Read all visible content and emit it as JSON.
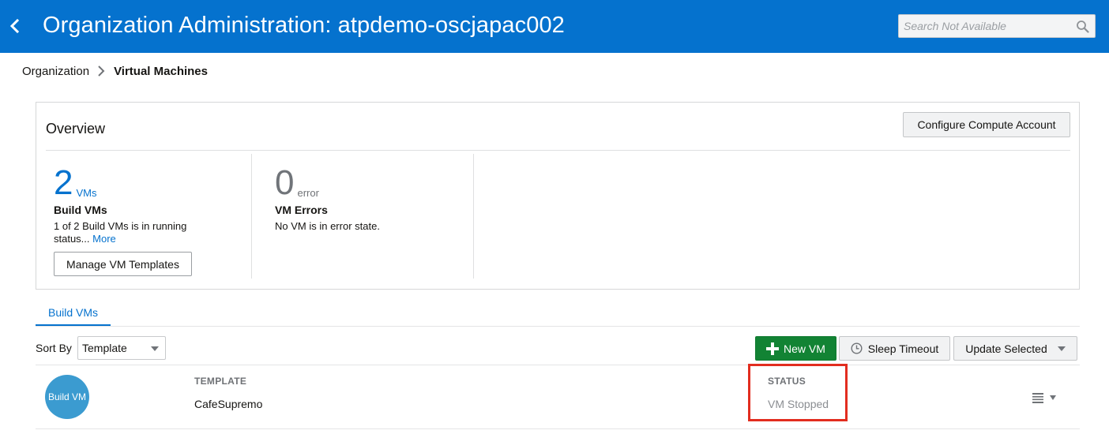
{
  "header": {
    "title": "Organization Administration: atpdemo-oscjapac002",
    "search_placeholder": "Search Not Available",
    "icons": {
      "back": "chevron-left-icon",
      "search": "magnifier-icon"
    },
    "bar_color": "#0572ce"
  },
  "breadcrumb": {
    "parent": "Organization",
    "current": "Virtual Machines",
    "separator_icon": "chevron-right-icon"
  },
  "overview": {
    "title": "Overview",
    "configure_button": "Configure Compute Account",
    "build_vms": {
      "count": "2",
      "unit": "VMs",
      "label": "Build VMs",
      "desc_line1": "1 of 2 Build VMs is in running",
      "desc_line2": "status...",
      "more_link": "More",
      "manage_button": "Manage VM Templates",
      "accent_color": "#0572ce"
    },
    "vm_errors": {
      "count": "0",
      "unit": "error",
      "label": "VM Errors",
      "desc": "No VM is in error state."
    }
  },
  "tabs": [
    {
      "label": "Build VMs",
      "active": true
    }
  ],
  "toolbar": {
    "sort_by_label": "Sort By",
    "sort_by_value": "Template",
    "new_vm_button": "New VM",
    "sleep_timeout_button": "Sleep Timeout",
    "update_selected_button": "Update Selected",
    "icons": {
      "new_vm": "plus-icon",
      "sleep_timeout": "clock-icon",
      "update_selected": "caret-down-icon"
    },
    "new_vm_color": "#128334"
  },
  "vm_list": [
    {
      "avatar_label": "Build VM",
      "template_header": "TEMPLATE",
      "template_value": "CafeSupremo",
      "status_header": "STATUS",
      "status_value": "VM Stopped",
      "status_highlighted": true,
      "highlight_color": "#e22d1f",
      "menu_icon": "hamburger-menu-icon"
    }
  ]
}
